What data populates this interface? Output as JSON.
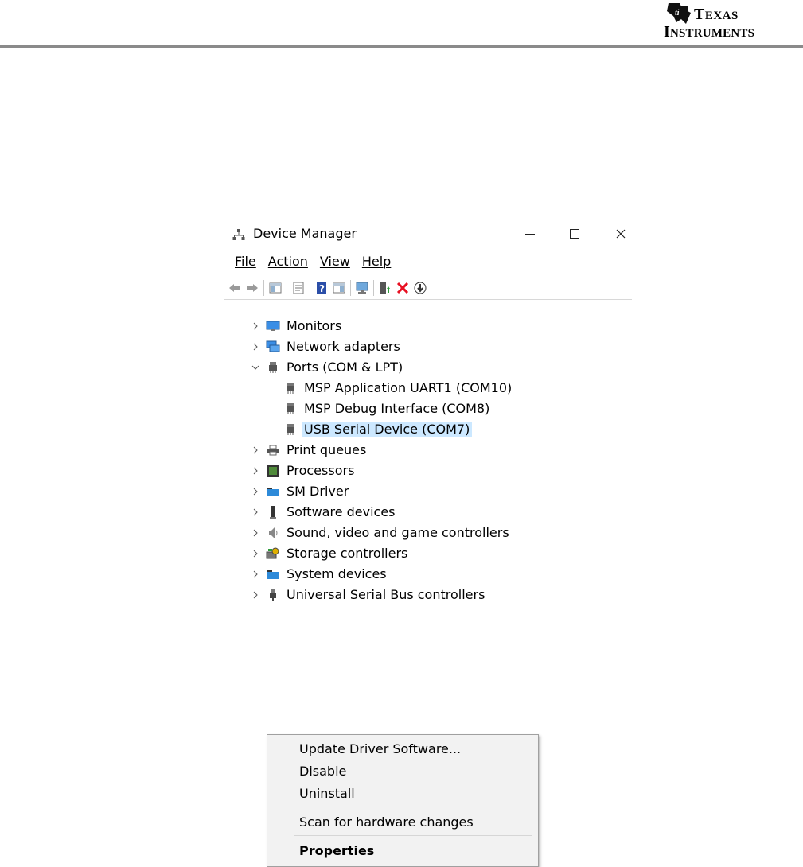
{
  "header": {
    "brand_line1_cap": "T",
    "brand_line1_rest": "EXAS",
    "brand_line2_cap": "I",
    "brand_line2_rest": "NSTRUMENTS"
  },
  "window": {
    "title": "Device Manager",
    "menu": [
      "File",
      "Action",
      "View",
      "Help"
    ],
    "toolbar_icons": [
      "back-arrow-icon",
      "forward-arrow-icon",
      "show-hide-console-tree-icon",
      "properties-icon",
      "help-icon",
      "action-pane-icon",
      "scan-hardware-icon",
      "update-driver-icon",
      "uninstall-icon",
      "disable-device-icon"
    ],
    "tree": [
      {
        "label": "Monitors",
        "icon": "monitor-icon",
        "expanded": false,
        "level": 0
      },
      {
        "label": "Network adapters",
        "icon": "network-adapter-icon",
        "expanded": false,
        "level": 0
      },
      {
        "label": "Ports (COM & LPT)",
        "icon": "port-icon",
        "expanded": true,
        "level": 0
      },
      {
        "label": "MSP Application UART1 (COM10)",
        "icon": "port-icon",
        "level": 1
      },
      {
        "label": "MSP Debug Interface (COM8)",
        "icon": "port-icon",
        "level": 1
      },
      {
        "label": "USB Serial Device (COM7)",
        "icon": "port-icon",
        "level": 1,
        "selected": true
      },
      {
        "label": "Print queues",
        "icon": "printer-icon",
        "expanded": false,
        "level": 0
      },
      {
        "label": "Processors",
        "icon": "processor-icon",
        "expanded": false,
        "level": 0
      },
      {
        "label": "SM Driver",
        "icon": "folder-icon",
        "expanded": false,
        "level": 0
      },
      {
        "label": "Software devices",
        "icon": "software-device-icon",
        "expanded": false,
        "level": 0
      },
      {
        "label": "Sound, video and game controllers",
        "icon": "speaker-icon",
        "expanded": false,
        "level": 0
      },
      {
        "label": "Storage controllers",
        "icon": "storage-controller-icon",
        "expanded": false,
        "level": 0
      },
      {
        "label": "System devices",
        "icon": "folder-icon",
        "expanded": false,
        "level": 0
      },
      {
        "label": "Universal Serial Bus controllers",
        "icon": "usb-icon",
        "expanded": false,
        "level": 0
      }
    ]
  },
  "context_menu": {
    "items": [
      {
        "label": "Update Driver Software...",
        "bold": false
      },
      {
        "label": "Disable",
        "bold": false
      },
      {
        "label": "Uninstall",
        "bold": false
      },
      {
        "separator": true
      },
      {
        "label": "Scan for hardware changes",
        "bold": false
      },
      {
        "separator": true
      },
      {
        "label": "Properties",
        "bold": true
      }
    ]
  },
  "colors": {
    "selection": "#cce8ff",
    "menu_bg": "#f2f2f2",
    "header_rule": "#8a8a8a",
    "uninstall_red": "#e81123"
  }
}
